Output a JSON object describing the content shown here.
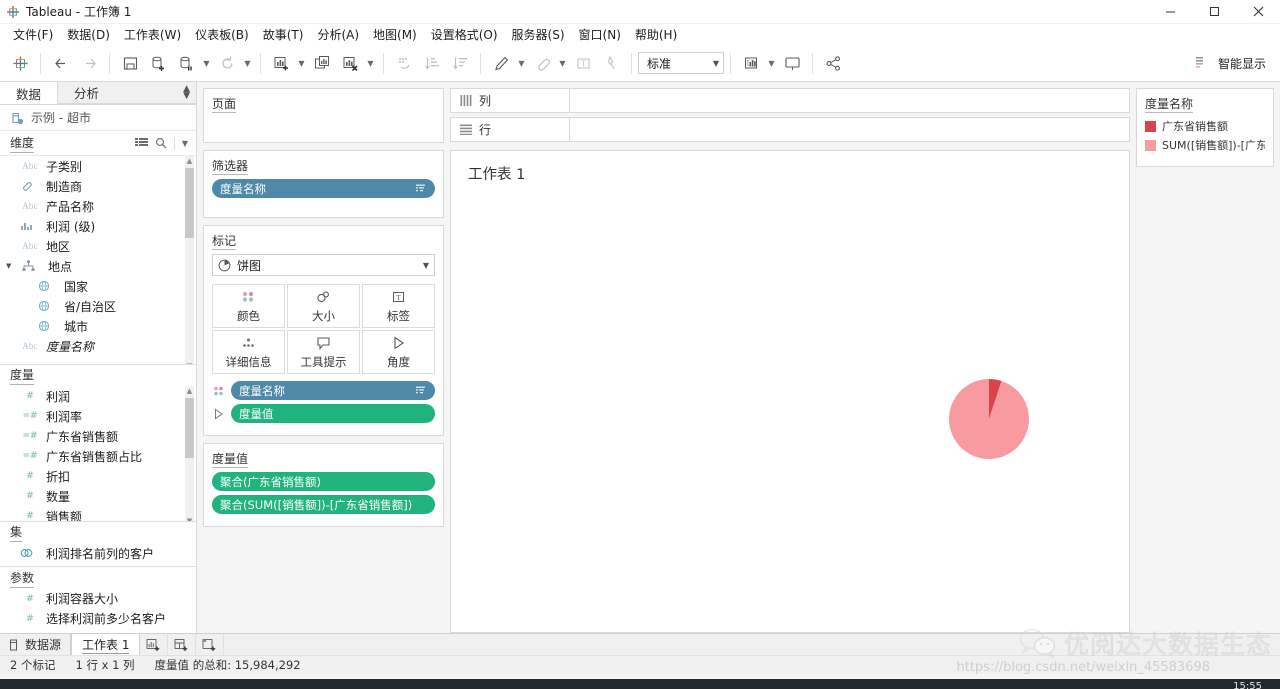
{
  "window": {
    "title": "Tableau - 工作簿 1",
    "minimize": "−",
    "maximize": "▢",
    "close": "✕",
    "app_icon": "tableau-logo-icon"
  },
  "menubar": [
    {
      "label": "文件(F)"
    },
    {
      "label": "数据(D)"
    },
    {
      "label": "工作表(W)"
    },
    {
      "label": "仪表板(B)"
    },
    {
      "label": "故事(T)"
    },
    {
      "label": "分析(A)"
    },
    {
      "label": "地图(M)"
    },
    {
      "label": "设置格式(O)"
    },
    {
      "label": "服务器(S)"
    },
    {
      "label": "窗口(N)"
    },
    {
      "label": "帮助(H)"
    }
  ],
  "toolbar": {
    "fit_value": "标准",
    "show_me_label": "智能显示",
    "buttons": [
      {
        "name": "tableau-logo-button"
      },
      {
        "name": "back-button"
      },
      {
        "name": "forward-button"
      },
      {
        "name": "save-button"
      },
      {
        "name": "new-data-source-button"
      },
      {
        "name": "pause-autoupdate-button"
      },
      {
        "name": "refresh-button"
      },
      {
        "name": "new-worksheet-button"
      },
      {
        "name": "duplicate-sheet-button"
      },
      {
        "name": "clear-sheet-button"
      },
      {
        "name": "swap-rows-columns-button"
      },
      {
        "name": "sort-ascending-button"
      },
      {
        "name": "sort-descending-button"
      },
      {
        "name": "highlight-button"
      },
      {
        "name": "group-members-button"
      },
      {
        "name": "show-mark-labels-button"
      },
      {
        "name": "fix-axes-button"
      },
      {
        "name": "presentation-mode-button"
      },
      {
        "name": "share-button"
      }
    ]
  },
  "data_pane": {
    "tabs": [
      {
        "label": "数据",
        "active": true
      },
      {
        "label": "分析",
        "active": false
      }
    ],
    "datasource": "示例 - 超市",
    "sections": [
      {
        "key": "dimensions",
        "title": "维度",
        "fields": [
          {
            "label": "子类别",
            "icon": "abc-icon",
            "indent": 0,
            "italic": false
          },
          {
            "label": "制造商",
            "icon": "link-icon",
            "indent": 0,
            "italic": false
          },
          {
            "label": "产品名称",
            "icon": "abc-icon",
            "indent": 0,
            "italic": false
          },
          {
            "label": "利润 (级)",
            "icon": "bin-icon",
            "indent": 0,
            "italic": false
          },
          {
            "label": "地区",
            "icon": "abc-icon",
            "indent": 0,
            "italic": false
          },
          {
            "label": "地点",
            "icon": "hierarchy-icon",
            "indent": 0,
            "italic": false,
            "expanded": true
          },
          {
            "label": "国家",
            "icon": "globe-icon",
            "indent": 1,
            "italic": false
          },
          {
            "label": "省/自治区",
            "icon": "globe-icon",
            "indent": 1,
            "italic": false
          },
          {
            "label": "城市",
            "icon": "globe-icon",
            "indent": 1,
            "italic": false
          },
          {
            "label": "度量名称",
            "icon": "abc-icon",
            "indent": 0,
            "italic": true
          }
        ]
      },
      {
        "key": "measures",
        "title": "度量",
        "fields": [
          {
            "label": "利润",
            "icon": "number-icon",
            "indent": 0,
            "calculated": false
          },
          {
            "label": "利润率",
            "icon": "calc-number-icon",
            "indent": 0,
            "calculated": true
          },
          {
            "label": "广东省销售额",
            "icon": "calc-number-icon",
            "indent": 0,
            "calculated": true
          },
          {
            "label": "广东省销售额占比",
            "icon": "calc-number-icon",
            "indent": 0,
            "calculated": true
          },
          {
            "label": "折扣",
            "icon": "number-icon",
            "indent": 0,
            "calculated": false
          },
          {
            "label": "数量",
            "icon": "number-icon",
            "indent": 0,
            "calculated": false
          },
          {
            "label": "销售额",
            "icon": "number-icon",
            "indent": 0,
            "calculated": false
          }
        ]
      },
      {
        "key": "sets",
        "title": "集",
        "fields": [
          {
            "label": "利润排名前列的客户",
            "icon": "set-icon",
            "indent": 0
          }
        ]
      },
      {
        "key": "parameters",
        "title": "参数",
        "fields": [
          {
            "label": "利润容器大小",
            "icon": "number-icon",
            "indent": 0
          },
          {
            "label": "选择利润前多少名客户",
            "icon": "number-icon",
            "indent": 0
          }
        ]
      }
    ]
  },
  "shelves": {
    "pages": {
      "title": "页面",
      "pills": []
    },
    "filters": {
      "title": "筛选器",
      "pills": [
        {
          "label": "度量名称",
          "color": "blue",
          "end": "filter-icon"
        }
      ]
    },
    "columns": {
      "title": "列",
      "icon": "columns-icon",
      "pills": []
    },
    "rows": {
      "title": "行",
      "icon": "rows-icon",
      "pills": []
    }
  },
  "marks": {
    "title": "标记",
    "mark_type": "饼图",
    "mark_type_icon": "pie-icon",
    "buttons": [
      {
        "label": "颜色",
        "icon": "color-icon"
      },
      {
        "label": "大小",
        "icon": "size-icon"
      },
      {
        "label": "标签",
        "icon": "label-icon"
      },
      {
        "label": "详细信息",
        "icon": "detail-icon"
      },
      {
        "label": "工具提示",
        "icon": "tooltip-icon"
      },
      {
        "label": "角度",
        "icon": "angle-icon"
      }
    ],
    "pills": [
      {
        "label": "度量名称",
        "color": "blue",
        "lead_icon": "color-icon",
        "end": "filter-icon"
      },
      {
        "label": "度量值",
        "color": "green",
        "lead_icon": "angle-icon",
        "end": ""
      }
    ]
  },
  "measure_values": {
    "title": "度量值",
    "pills": [
      {
        "label": "聚合(广东省销售额)",
        "color": "green"
      },
      {
        "label": "聚合(SUM([销售额])-[广东省销售额])",
        "color": "green"
      }
    ]
  },
  "worksheet": {
    "title": "工作表 1"
  },
  "legend": {
    "title": "度量名称",
    "items": [
      {
        "label": "广东省销售额",
        "color": "#d9434a"
      },
      {
        "label": "SUM([销售额])-[广东...",
        "color": "#f79ba0"
      }
    ]
  },
  "chart_data": {
    "type": "pie",
    "title": "工作表 1",
    "labels": [
      "广东省销售额",
      "SUM([销售额])-[广东省销售额]"
    ],
    "values": [
      5.0,
      95.0
    ],
    "colors": [
      "#d9434a",
      "#f79ba0"
    ],
    "radius_px": 40,
    "center": [
      537,
      267
    ],
    "legend_position": "right",
    "legend_title": "度量名称",
    "total_label": "度量值 的总和: 15,984,292"
  },
  "bottom": {
    "datasource_tab": "数据源",
    "sheet_tab": "工作表 1",
    "new_worksheet_icon": "new-worksheet-icon",
    "new_dashboard_icon": "new-dashboard-icon",
    "new_story_icon": "new-story-icon"
  },
  "statusbar": {
    "marks": "2 个标记",
    "size": "1 行 x 1 列",
    "sum": "度量值 的总和: 15,984,292"
  },
  "watermark": {
    "text": "优阅达大数据生态",
    "url": "https://blog.csdn.net/weixin_45583698",
    "icon": "wechat-icon"
  },
  "clock": "15:55"
}
